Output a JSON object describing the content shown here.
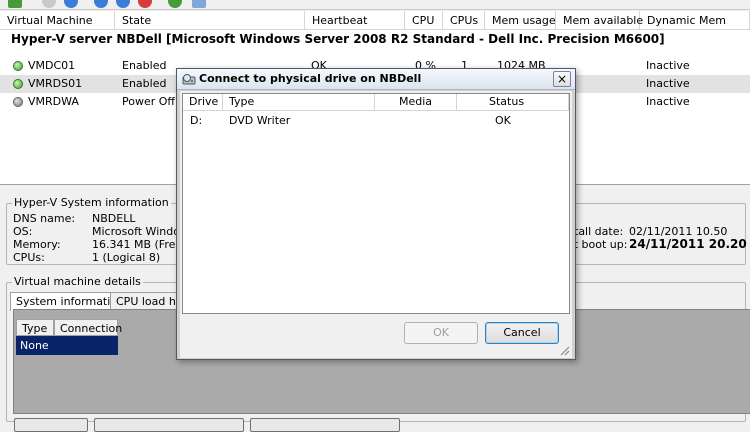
{
  "toolbar": {
    "icons": [
      "export-icon",
      "back-icon",
      "forward-icon",
      "start-icon",
      "stop-icon",
      "refresh-icon",
      "report-icon"
    ]
  },
  "vm_list": {
    "columns": [
      "Virtual Machine",
      "State",
      "Heartbeat",
      "CPU",
      "CPUs",
      "Mem usage",
      "Mem available",
      "Dynamic Mem"
    ],
    "group_title": "Hyper-V server NBDell [Microsoft Windows Server 2008 R2 Standard - Dell Inc. Precision M6600]",
    "rows": [
      {
        "name": "VMDC01",
        "state": "Enabled",
        "heartbeat": "OK",
        "cpu": "0 %",
        "cpus": "1",
        "mem_usage": "1024 MB",
        "dynamic_mem": "Inactive",
        "status_color": "green"
      },
      {
        "name": "VMRDS01",
        "state": "Enabled",
        "dynamic_mem": "Inactive",
        "status_color": "green"
      },
      {
        "name": "VMRDWA",
        "state": "Power Off",
        "dynamic_mem": "Inactive",
        "status_color": "grey"
      }
    ]
  },
  "sysinfo": {
    "legend": "Hyper-V System information",
    "labels": [
      "DNS name:",
      "OS:",
      "Memory:",
      "CPUs:"
    ],
    "values": [
      "NBDELL",
      "Microsoft Window",
      "16.341 MB (Free",
      "1 (Logical 8)"
    ],
    "install_label": "tall date:",
    "install_value": "02/11/2011 10.50",
    "boot_label": "st boot up:",
    "boot_value": "24/11/2011 20.20"
  },
  "details": {
    "legend": "Virtual machine details",
    "tabs": [
      "System information",
      "CPU load his"
    ],
    "grid_columns": [
      "Type",
      "Connection"
    ],
    "selected_value": "None"
  },
  "dialog": {
    "title": "Connect to physical drive on NBDell",
    "close_label": "×",
    "columns": [
      "Drive",
      "Type",
      "Media",
      "Status"
    ],
    "rows": [
      {
        "drive": "D:",
        "type": "DVD Writer",
        "media": "",
        "status": "OK"
      }
    ],
    "ok_label": "OK",
    "cancel_label": "Cancel"
  },
  "colors": {
    "selection": "#0a246a",
    "details_bg": "#aaaaaa",
    "status_green": "#3ea02c",
    "status_grey": "#7a7a7a"
  }
}
